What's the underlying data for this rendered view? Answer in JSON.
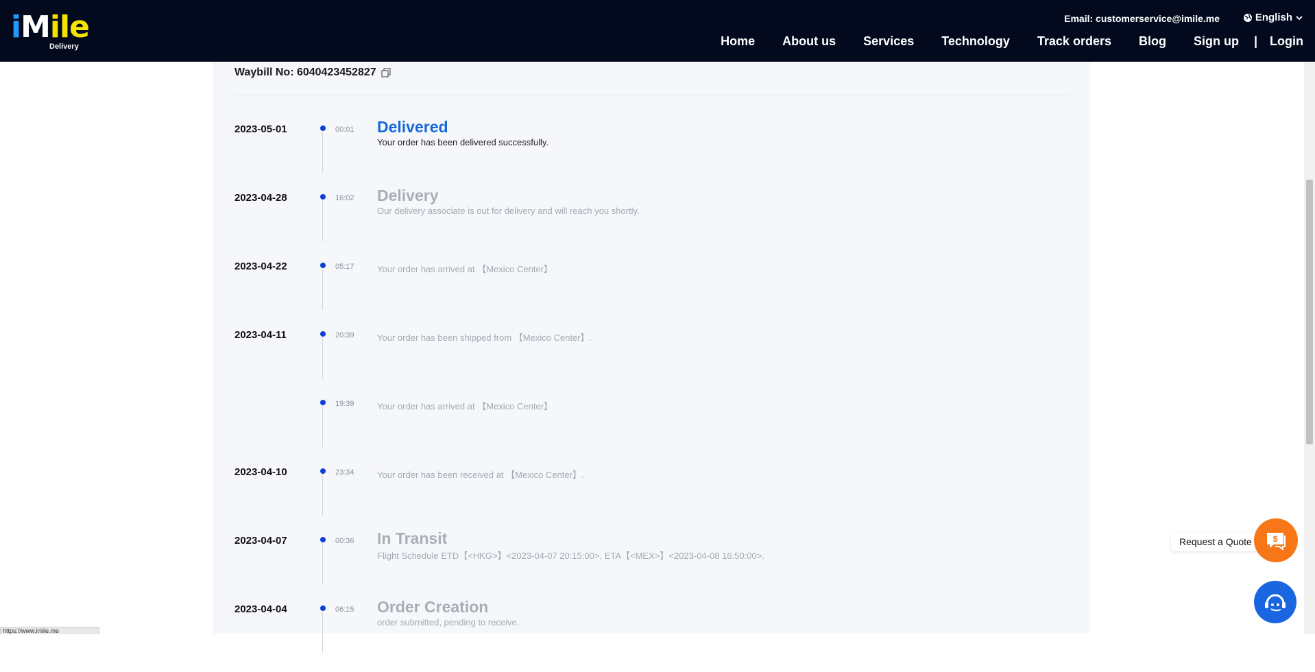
{
  "header": {
    "logo_text_i": "i",
    "logo_text_m": "M",
    "logo_text_i2": "i",
    "logo_text_le": "le",
    "logo_sub": "Delivery",
    "contact": "Email: customerservice@imile.me",
    "language": "English",
    "nav": [
      {
        "label": "Home"
      },
      {
        "label": "About us"
      },
      {
        "label": "Services"
      },
      {
        "label": "Technology"
      },
      {
        "label": "Track orders"
      },
      {
        "label": "Blog"
      },
      {
        "label": "Sign up"
      }
    ],
    "separator": "|",
    "login": "Login"
  },
  "tracking": {
    "waybill": "Waybill No: 6040423452827",
    "events": [
      {
        "date": "2023-05-01",
        "time": "00:01",
        "title": "Delivered",
        "desc": "Your order has been delivered successfully."
      },
      {
        "date": "2023-04-28",
        "time": "16:02",
        "title": "Delivery",
        "desc": "Our delivery associate is out for delivery and will reach you shortly."
      },
      {
        "date": "2023-04-22",
        "time": "05:17",
        "title": "",
        "desc": "Your order has arrived at 【Mexico Center】"
      },
      {
        "date": "2023-04-11",
        "time": "20:39",
        "title": "",
        "desc": "Your order has been shipped from 【Mexico Center】."
      },
      {
        "date": "",
        "time": "19:39",
        "title": "",
        "desc": "Your order has arrived at 【Mexico Center】"
      },
      {
        "date": "2023-04-10",
        "time": "23:34",
        "title": "",
        "desc": "Your order has been received at 【Mexico Center】."
      },
      {
        "date": "2023-04-07",
        "time": "00:36",
        "title": "In Transit",
        "desc": "Flight Schedule ETD【<HKG>】<2023-04-07 20:15:00>, ETA【<MEX>】<2023-04-08 16:50:00>."
      },
      {
        "date": "2023-04-04",
        "time": "06:15",
        "title": "Order Creation",
        "desc": "order submitted, pending to receive."
      }
    ]
  },
  "widgets": {
    "quote_label": "Request a Quote",
    "quote_icon_text": "$",
    "status_url": "https://www.imile.me"
  },
  "colors": {
    "header_bg": "#030a1e",
    "accent_blue": "#1667d9",
    "dot_blue": "#0d3fd8",
    "quote_orange": "#f77718",
    "chat_blue": "#1a66e0"
  }
}
